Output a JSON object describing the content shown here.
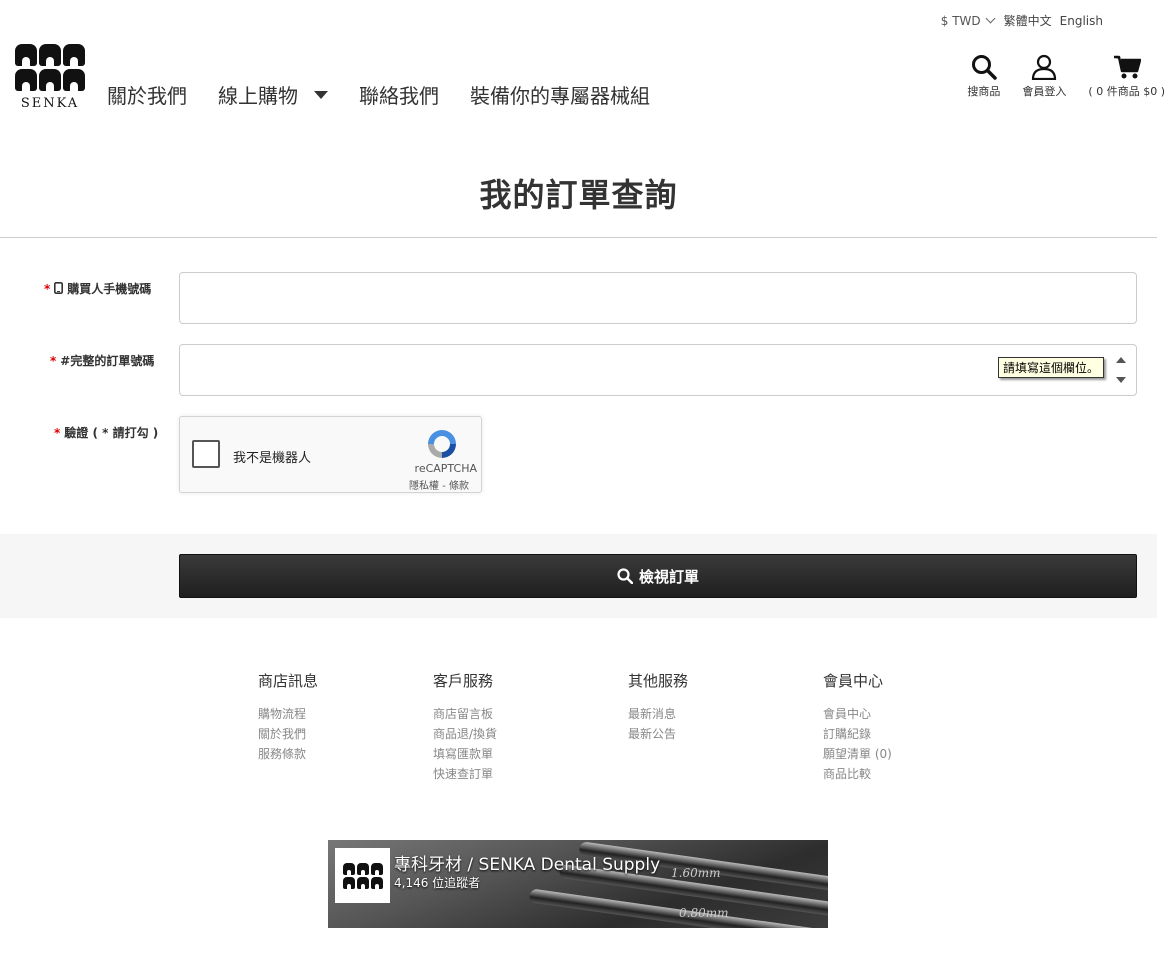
{
  "topbar": {
    "currency": "$ TWD",
    "lang_zh": "繁體中文",
    "lang_en": "English"
  },
  "logo": {
    "text": "SENKA"
  },
  "nav": {
    "items": [
      {
        "label": "關於我們"
      },
      {
        "label": "線上購物"
      },
      {
        "label": "聯絡我們"
      },
      {
        "label": "裝備你的專屬器械組"
      }
    ]
  },
  "tools": {
    "search": "搜商品",
    "login": "會員登入",
    "cart": "( 0 件商品 $0 )"
  },
  "page": {
    "title": "我的訂單查詢"
  },
  "form": {
    "phone_label": "購買人手機號碼",
    "order_label": "#完整的訂單號碼",
    "verify_label": "驗證 ( * 請打勾 )",
    "required_mark": "*",
    "phone_value": "",
    "order_value": "",
    "tooltip": "請填寫這個欄位。",
    "recaptcha": {
      "text": "我不是機器人",
      "brand": "reCAPTCHA",
      "links": "隱私權 - 條款"
    },
    "submit": "檢視訂單"
  },
  "footer": {
    "columns": [
      {
        "title": "商店訊息",
        "links": [
          "購物流程",
          "關於我們",
          "服務條款"
        ]
      },
      {
        "title": "客戶服務",
        "links": [
          "商店留言板",
          "商品退/換貨",
          "填寫匯款單",
          "快速查訂單"
        ]
      },
      {
        "title": "其他服務",
        "links": [
          "最新消息",
          "最新公告"
        ]
      },
      {
        "title": "會員中心",
        "links": [
          "會員中心",
          "訂購紀錄",
          "願望清單 (0)",
          "商品比較"
        ]
      }
    ]
  },
  "facebook": {
    "name": "專科牙材 / SENKA Dental Supply",
    "followers": "4,146 位追蹤者",
    "mark1": "1.60mm",
    "mark2": "0.80mm"
  }
}
